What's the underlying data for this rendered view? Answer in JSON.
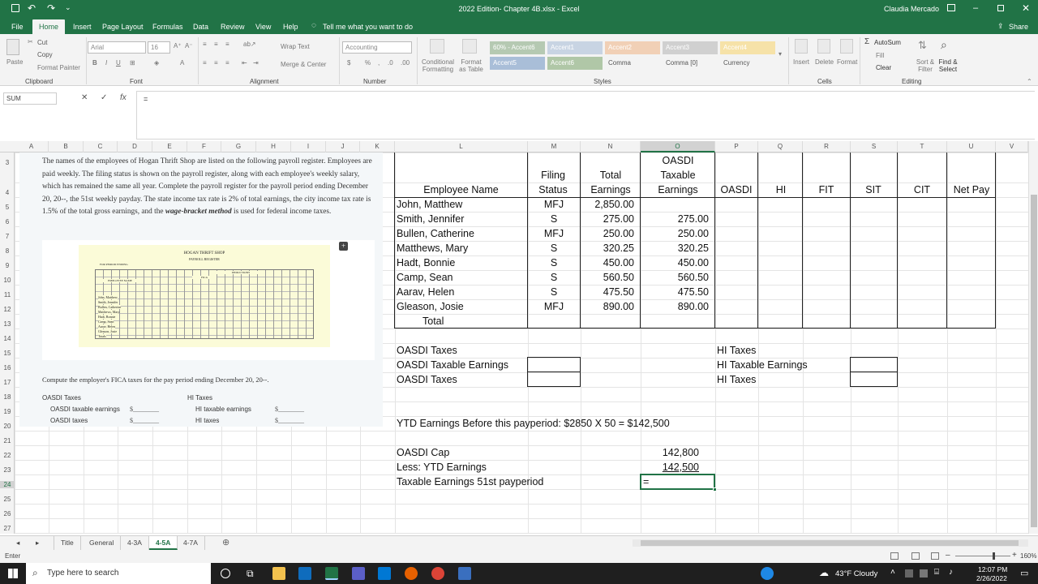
{
  "titlebar": {
    "file_title": "2022 Edition- Chapter 4B.xlsx - Excel",
    "user": "Claudia Mercado"
  },
  "ribbon_tabs": [
    "File",
    "Home",
    "Insert",
    "Page Layout",
    "Formulas",
    "Data",
    "Review",
    "View",
    "Help"
  ],
  "tell_me": "Tell me what you want to do",
  "share": "Share",
  "ribbon": {
    "cut": "Cut",
    "copy": "Copy",
    "format_painter": "Format Painter",
    "paste": "Paste",
    "font_name": "Arial",
    "font_size": "16",
    "wrap_text": "Wrap Text",
    "merge_center": "Merge & Center",
    "number_format": "Accounting",
    "conditional_formatting": "Conditional Formatting",
    "format_as_table": "Format as Table",
    "styles": [
      "60% - Accent6",
      "Accent1",
      "Accent2",
      "Accent3",
      "Accent4",
      "Accent5",
      "Accent6",
      "Comma",
      "Comma [0]",
      "Currency"
    ],
    "insert": "Insert",
    "delete": "Delete",
    "format": "Format",
    "autosum": "AutoSum",
    "fill": "Fill",
    "clear": "Clear",
    "sort_filter": "Sort & Filter",
    "find_select": "Find & Select",
    "groups": [
      "Clipboard",
      "Font",
      "Alignment",
      "Number",
      "Styles",
      "Cells",
      "Editing"
    ]
  },
  "formula_bar": {
    "name_box": "SUM",
    "formula": "="
  },
  "columns": [
    "A",
    "B",
    "C",
    "D",
    "E",
    "F",
    "G",
    "H",
    "I",
    "J",
    "K",
    "L",
    "M",
    "N",
    "O",
    "P",
    "Q",
    "R",
    "S",
    "T",
    "U",
    "V"
  ],
  "rows": [
    "3",
    "4",
    "5",
    "6",
    "7",
    "8",
    "9",
    "10",
    "11",
    "12",
    "13",
    "14",
    "15",
    "16",
    "17",
    "18",
    "19",
    "20",
    "21",
    "22",
    "23",
    "24",
    "25",
    "26",
    "27"
  ],
  "headers": {
    "employee_name": "Employee Name",
    "filing_status": "Filing Status",
    "total_earnings": "Total Earnings",
    "oasdi_taxable": "OASDI Taxable Earnings",
    "oasdi": "OASDI",
    "hi": "HI",
    "fit": "FIT",
    "sit": "SIT",
    "cit": "CIT",
    "net_pay": "Net Pay"
  },
  "employees": [
    {
      "name": "John, Matthew",
      "status": "MFJ",
      "total": "2,850.00",
      "taxable": ""
    },
    {
      "name": "Smith, Jennifer",
      "status": "S",
      "total": "275.00",
      "taxable": "275.00"
    },
    {
      "name": "Bullen, Catherine",
      "status": "MFJ",
      "total": "250.00",
      "taxable": "250.00"
    },
    {
      "name": "Matthews, Mary",
      "status": "S",
      "total": "320.25",
      "taxable": "320.25"
    },
    {
      "name": "Hadt, Bonnie",
      "status": "S",
      "total": "450.00",
      "taxable": "450.00"
    },
    {
      "name": "Camp, Sean",
      "status": "S",
      "total": "560.50",
      "taxable": "560.50"
    },
    {
      "name": "Aarav, Helen",
      "status": "S",
      "total": "475.50",
      "taxable": "475.50"
    },
    {
      "name": "Gleason, Josie",
      "status": "MFJ",
      "total": "890.00",
      "taxable": "890.00"
    }
  ],
  "total_label": "Total",
  "summary": {
    "oasdi_taxes_header": "OASDI Taxes",
    "oasdi_taxable_earnings": "OASDI Taxable Earnings",
    "oasdi_taxes": "OASDI Taxes",
    "hi_taxes_header": "HI Taxes",
    "hi_taxable_earnings": "HI Taxable Earnings",
    "hi_taxes": "HI Taxes"
  },
  "ytd_note": "YTD Earnings Before this payperiod: $2850 X 50 = $142,500",
  "cap": {
    "oasdi_cap_label": "OASDI Cap",
    "oasdi_cap_value": "142,800",
    "less_ytd_label": "Less: YTD Earnings",
    "less_ytd_value": "142,500",
    "taxable_label": "Taxable Earnings 51st payperiod",
    "active_cell": "="
  },
  "problem": {
    "paragraph_1": "The names of the employees of Hogan Thrift Shop are listed on the following payroll register. Employees are paid weekly. The filing status is shown on the payroll register, along with each employee's weekly salary, which has remained the same all year. Complete the payroll register for the payroll period ending December 20, 20--, the 51st weekly payday. The state income tax rate is 2% of total earnings, the city income tax rate is 1.5% of the total gross earnings, and the",
    "paragraph_1_em": "wage-bracket method",
    "paragraph_1_end": "is used for federal income taxes.",
    "thumb_title": "HOGAN THRIFT SHOP",
    "thumb_subtitle": "PAYROLL REGISTER",
    "thumb_period": "FOR PERIOD ENDING",
    "thumb_col_employee": "EMPLOYEE NAME",
    "thumb_col_deductions": "DEDUCTIONS",
    "thumb_col_fica": "FICA",
    "thumb_names": [
      "John, Matthew",
      "Smith, Jennifer",
      "Bullen, Catherine",
      "Matthews, Mary",
      "Hadt, Bonnie",
      "Camp, Sean",
      "Aarav, Helen",
      "Gleason, Josie",
      "Totals"
    ],
    "compute": "Compute the employer's FICA taxes for the pay period ending December 20, 20--.",
    "oasdi_taxes": "OASDI Taxes",
    "oasdi_taxable_earnings": "OASDI taxable earnings",
    "oasdi_taxes_lower": "OASDI taxes",
    "hi_taxes": "HI Taxes",
    "hi_taxable_earnings": "HI taxable earnings",
    "hi_taxes_lower": "HI taxes",
    "blank": "$________"
  },
  "sheet_tabs": [
    "Title",
    "General",
    "4-3A",
    "4-5A",
    "4-7A"
  ],
  "active_sheet": "4-5A",
  "status": "Enter",
  "zoom": "160%",
  "taskbar": {
    "search": "Type here to search",
    "weather": "43°F  Cloudy",
    "time": "12:07 PM",
    "date": "2/26/2022"
  }
}
